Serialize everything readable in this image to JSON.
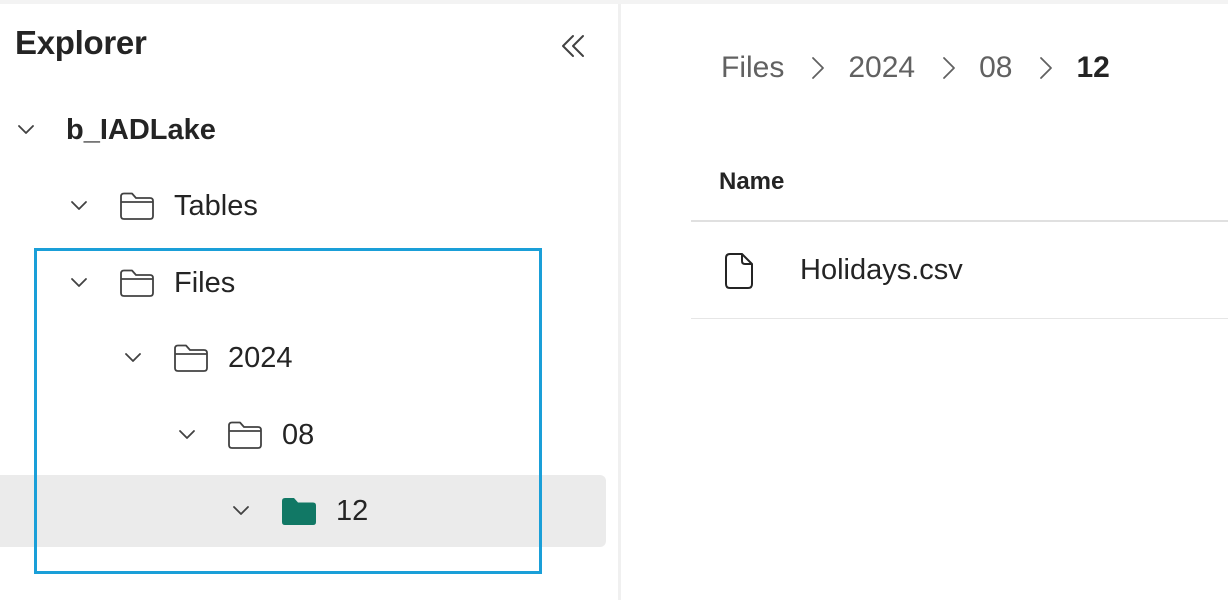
{
  "explorer": {
    "title": "Explorer",
    "collapse_icon": "double-chevron-left-icon"
  },
  "tree": {
    "root": {
      "label": "b_IADLake",
      "expanded": true
    },
    "tables": {
      "label": "Tables",
      "expanded": true,
      "icon": "folder-outline-icon"
    },
    "files": {
      "label": "Files",
      "expanded": true,
      "icon": "folder-outline-icon"
    },
    "year": {
      "label": "2024",
      "expanded": true,
      "icon": "folder-outline-icon"
    },
    "month": {
      "label": "08",
      "expanded": true,
      "icon": "folder-outline-icon"
    },
    "day": {
      "label": "12",
      "expanded": true,
      "selected": true,
      "icon": "folder-filled-icon"
    }
  },
  "breadcrumb": {
    "items": [
      "Files",
      "2024",
      "08",
      "12"
    ],
    "separator_icon": "chevron-right-icon"
  },
  "table": {
    "column_header": "Name",
    "rows": [
      {
        "name": "Holidays.csv",
        "icon": "document-icon"
      }
    ]
  },
  "colors": {
    "selection_bg": "#ebebeb",
    "highlight_border": "#1a9fd8",
    "selected_folder": "#117865",
    "text": "#242424",
    "muted_text": "#616161"
  }
}
